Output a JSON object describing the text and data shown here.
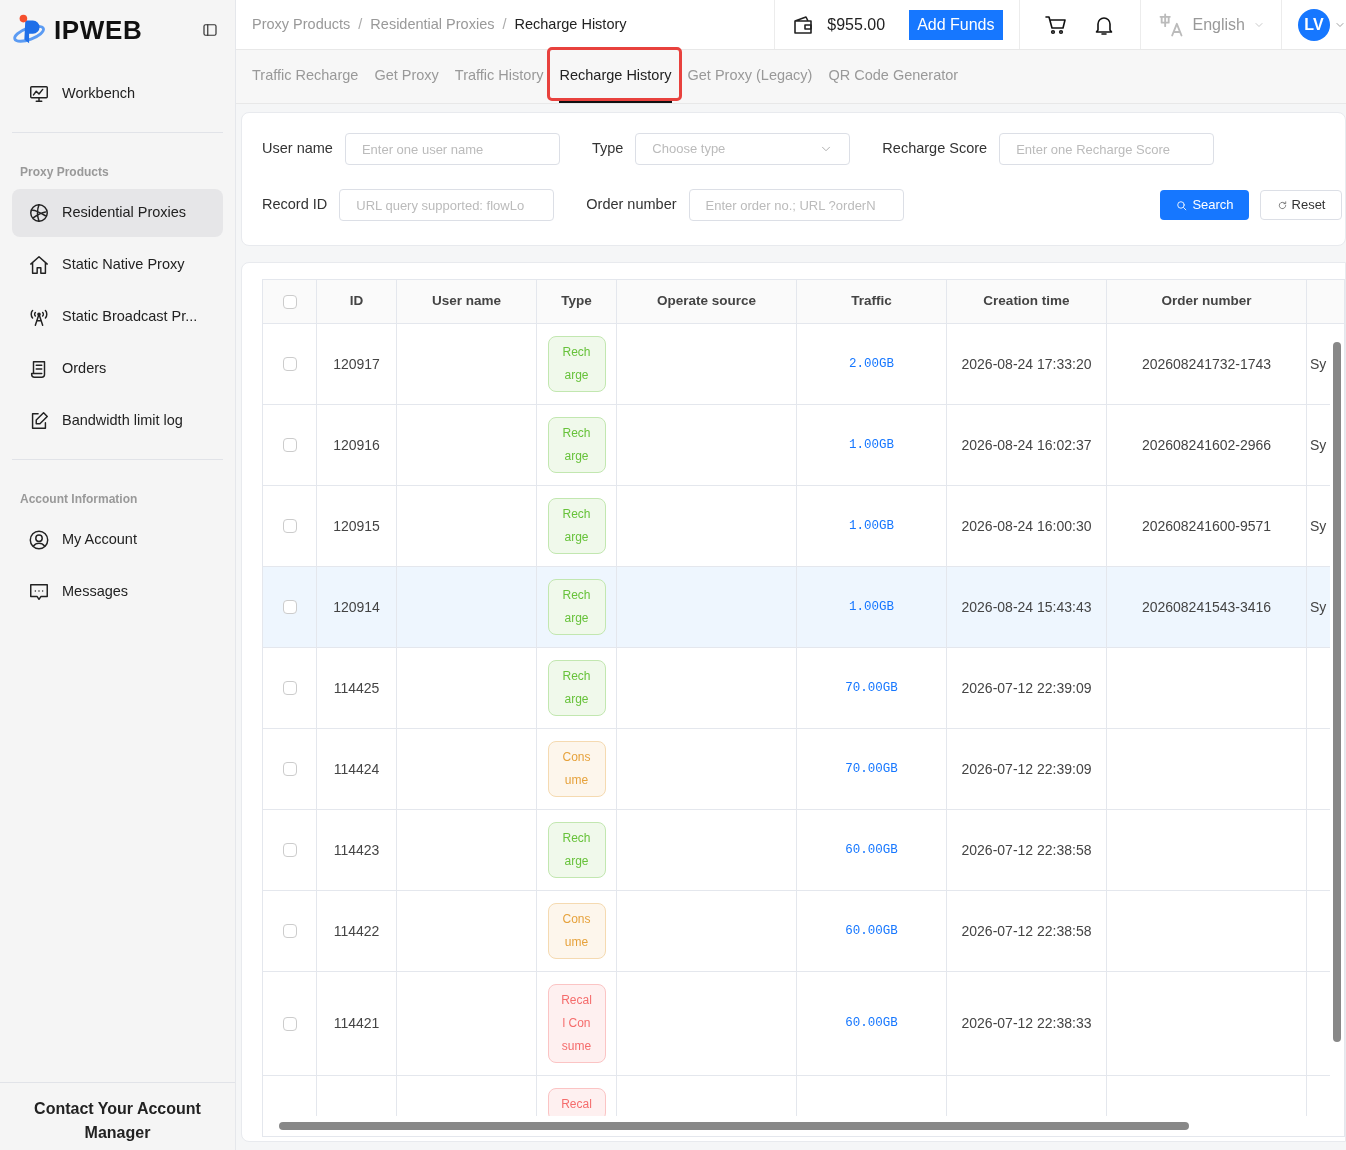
{
  "sidebar": {
    "logo": "IPWEB",
    "sections": [
      {
        "items": [
          {
            "label": "Workbench",
            "selected": false
          }
        ]
      },
      {
        "title": "Proxy Products",
        "items": [
          {
            "label": "Residential Proxies",
            "selected": true
          },
          {
            "label": "Static Native Proxy",
            "selected": false
          },
          {
            "label": "Static Broadcast Pr...",
            "selected": false
          },
          {
            "label": "Orders",
            "selected": false
          },
          {
            "label": "Bandwidth limit log",
            "selected": false
          }
        ]
      },
      {
        "title": "Account Information",
        "items": [
          {
            "label": "My Account",
            "selected": false
          },
          {
            "label": "Messages",
            "selected": false
          }
        ]
      }
    ],
    "footer": "Contact Your Account Manager"
  },
  "header": {
    "breadcrumb_separators": [
      "/",
      "/"
    ],
    "breadcrumbs": [
      "Proxy Products",
      "Residential Proxies",
      "Recharge History"
    ],
    "balance": "$955.00",
    "add_funds": "Add Funds",
    "language": "English",
    "avatar": "LV"
  },
  "tabs": [
    {
      "label": "Traffic Recharge",
      "selected": false,
      "annotated": false
    },
    {
      "label": "Get Proxy",
      "selected": false,
      "annotated": false
    },
    {
      "label": "Traffic History",
      "selected": false,
      "annotated": false
    },
    {
      "label": "Recharge History",
      "selected": true,
      "annotated": true
    },
    {
      "label": "Get Proxy (Legacy)",
      "selected": false,
      "annotated": false
    },
    {
      "label": "QR Code Generator",
      "selected": false,
      "annotated": false
    }
  ],
  "filters": {
    "user_name": {
      "label": "User name",
      "placeholder": "Enter one user name"
    },
    "type": {
      "label": "Type",
      "placeholder": "Choose type"
    },
    "recharge_score": {
      "label": "Recharge Score",
      "placeholder": "Enter one Recharge Score"
    },
    "record_id": {
      "label": "Record ID",
      "placeholder": "URL query supported: flowLo"
    },
    "order_number": {
      "label": "Order number",
      "placeholder": "Enter order no.; URL ?orderN"
    },
    "search": "Search",
    "reset": "Reset"
  },
  "table": {
    "select_all": {
      "checked": false
    },
    "columns": [
      "ID",
      "User name",
      "Type",
      "Operate source",
      "Traffic",
      "Creation time",
      "Order number"
    ],
    "rows": [
      {
        "checked": false,
        "highlighted": false,
        "id": "120917",
        "type": {
          "label": "Recharge",
          "kind": "recharge"
        },
        "traffic": "2.00GB",
        "time": "2026-08-24 17:33:20",
        "order": "202608241732-1743",
        "column_9": "Sy"
      },
      {
        "checked": false,
        "highlighted": false,
        "id": "120916",
        "type": {
          "label": "Recharge",
          "kind": "recharge"
        },
        "traffic": "1.00GB",
        "time": "2026-08-24 16:02:37",
        "order": "202608241602-2966",
        "column_9": "Sy"
      },
      {
        "checked": false,
        "highlighted": false,
        "id": "120915",
        "type": {
          "label": "Recharge",
          "kind": "recharge"
        },
        "traffic": "1.00GB",
        "time": "2026-08-24 16:00:30",
        "order": "202608241600-9571",
        "column_9": "Sy"
      },
      {
        "checked": false,
        "highlighted": true,
        "id": "120914",
        "type": {
          "label": "Recharge",
          "kind": "recharge"
        },
        "traffic": "1.00GB",
        "time": "2026-08-24 15:43:43",
        "order": "202608241543-3416",
        "column_9": "Sy"
      },
      {
        "checked": false,
        "highlighted": false,
        "id": "114425",
        "type": {
          "label": "Recharge",
          "kind": "recharge"
        },
        "traffic": "70.00GB",
        "time": "2026-07-12 22:39:09"
      },
      {
        "checked": false,
        "highlighted": false,
        "id": "114424",
        "type": {
          "label": "Consume",
          "kind": "consume"
        },
        "traffic": "70.00GB",
        "time": "2026-07-12 22:39:09"
      },
      {
        "checked": false,
        "highlighted": false,
        "id": "114423",
        "type": {
          "label": "Recharge",
          "kind": "recharge"
        },
        "traffic": "60.00GB",
        "time": "2026-07-12 22:38:58"
      },
      {
        "checked": false,
        "highlighted": false,
        "id": "114422",
        "type": {
          "label": "Consume",
          "kind": "consume"
        },
        "traffic": "60.00GB",
        "time": "2026-07-12 22:38:58"
      },
      {
        "checked": false,
        "highlighted": false,
        "id": "114421",
        "type": {
          "label": "Recall Consume",
          "kind": "recall"
        },
        "traffic": "60.00GB",
        "time": "2026-07-12 22:38:33"
      },
      {
        "type": {
          "label": "Recal",
          "kind": "recall"
        }
      }
    ]
  }
}
